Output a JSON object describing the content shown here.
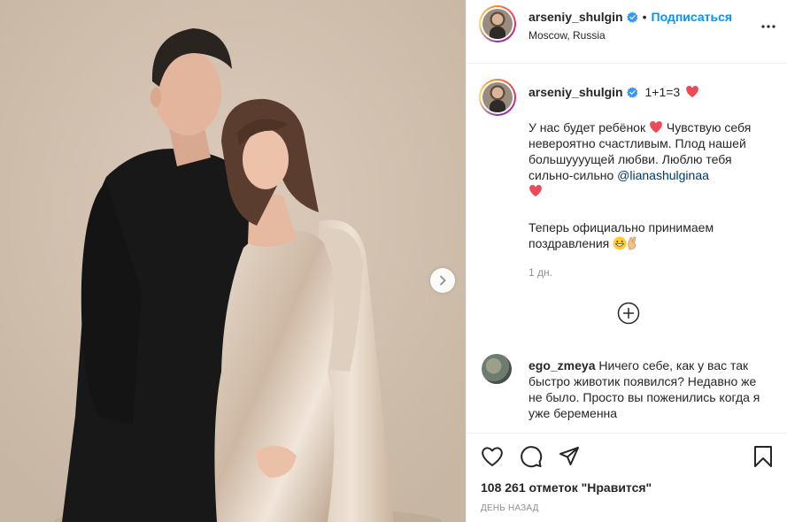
{
  "post": {
    "author": {
      "username": "arseniy_shulgin",
      "location": "Moscow, Russia",
      "follow_label": "Подписаться",
      "separator": "•"
    },
    "caption": {
      "title": "1+1=3",
      "line1": "У нас будет ребёнок",
      "line2": "Чувствую себя невероятно счастливым. Плод нашей большуууущей любви. Люблю тебя сильно-сильно",
      "mention": "@lianashulginaa",
      "line3": "Теперь официально принимаем поздравления",
      "time": "1 дн."
    },
    "load_more_icon": "plus-circle-icon",
    "comment": {
      "username": "ego_zmeya",
      "text": "Ничего себе, как у вас так быстро животик появился? Недавно же не было. Просто вы поженились когда я уже беременна"
    },
    "likes": "108 261 отметок \"Нравится\"",
    "date": "ДЕНЬ НАЗАД"
  },
  "icons": {
    "verified": "verified-badge-icon",
    "heart_emoji": "red-heart-emoji",
    "grin_emoji": "grinning-emoji",
    "fingers_emoji": "crossed-fingers-emoji",
    "like": "heart-outline-icon",
    "comment": "comment-bubble-icon",
    "share": "paper-plane-icon",
    "save": "bookmark-icon",
    "more": "ellipsis-icon",
    "next": "chevron-right-icon"
  },
  "colors": {
    "accent": "#0095f6",
    "mention": "#00376b",
    "heart": "#ed4956",
    "verified": "#3897f0",
    "muted": "#8e8e8e"
  }
}
